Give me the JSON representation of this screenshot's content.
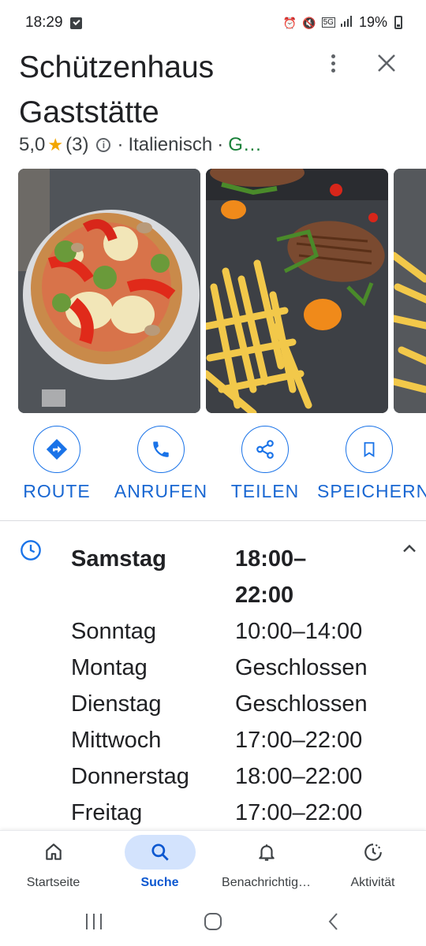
{
  "status_bar": {
    "time": "18:29",
    "battery": "19%",
    "icons": [
      "message-icon",
      "alarm-icon",
      "mute-icon",
      "5g-icon",
      "signal-icon",
      "battery-icon"
    ]
  },
  "place": {
    "name": "Schützenhaus Gaststätte",
    "rating": "5,0",
    "review_count": "(3)",
    "category": "Italienisch",
    "extra": "G…",
    "separator": "·"
  },
  "photos": [
    {
      "description_icon": "pizza-photo"
    },
    {
      "description_icon": "steak-fries-photo"
    },
    {
      "description_icon": "fries-photo"
    }
  ],
  "actions": {
    "route": "ROUTE",
    "call": "ANRUFEN",
    "share": "TEILEN",
    "save": "SPEICHERN"
  },
  "hours": [
    {
      "day": "Samstag",
      "time": "18:00–\n22:00",
      "today": true
    },
    {
      "day": "Sonntag",
      "time": "10:00–14:00"
    },
    {
      "day": "Montag",
      "time": "Geschlossen"
    },
    {
      "day": "Dienstag",
      "time": "Geschlossen"
    },
    {
      "day": "Mittwoch",
      "time": "17:00–22:00"
    },
    {
      "day": "Donnerstag",
      "time": "18:00–22:00"
    },
    {
      "day": "Freitag",
      "time": "17:00–22:00"
    }
  ],
  "bottom_nav": {
    "home": "Startseite",
    "search": "Suche",
    "notifications": "Benachrichtig…",
    "activity": "Aktivität"
  },
  "colors": {
    "accent": "#1a73e8",
    "star": "#f2a600",
    "green": "#188038",
    "active_pill": "#d3e3fd"
  }
}
